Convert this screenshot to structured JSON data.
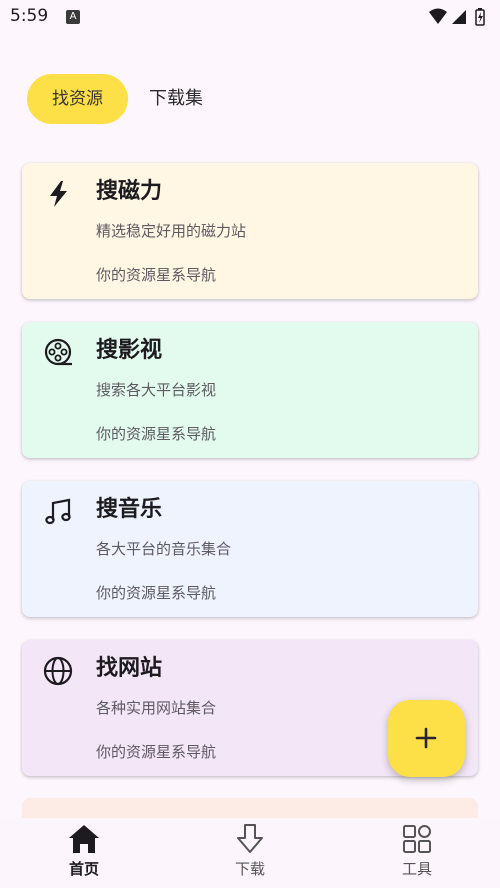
{
  "status_bar": {
    "time": "5:59",
    "app_icon_letter": "A"
  },
  "tabs": [
    {
      "label": "找资源",
      "active": true
    },
    {
      "label": "下载集",
      "active": false
    }
  ],
  "cards": [
    {
      "title": "搜磁力",
      "description": "精选稳定好用的磁力站",
      "tag": "你的资源星系导航",
      "icon": "lightning-icon",
      "bg": "#fff7e3"
    },
    {
      "title": "搜影视",
      "description": "搜索各大平台影视",
      "tag": "你的资源星系导航",
      "icon": "film-reel-icon",
      "bg": "#e3fbee"
    },
    {
      "title": "搜音乐",
      "description": "各大平台的音乐集合",
      "tag": "你的资源星系导航",
      "icon": "music-note-icon",
      "bg": "#eef3fe"
    },
    {
      "title": "找网站",
      "description": "各种实用网站集合",
      "tag": "你的资源星系导航",
      "icon": "globe-icon",
      "bg": "#f3e6f7"
    }
  ],
  "partial_card_bg": "#fdebe6",
  "fab": {
    "icon": "plus-icon",
    "color": "#fde047"
  },
  "bottom_nav": [
    {
      "label": "首页",
      "icon": "home-icon",
      "active": true
    },
    {
      "label": "下载",
      "icon": "download-icon",
      "active": false
    },
    {
      "label": "工具",
      "icon": "grid-icon",
      "active": false
    }
  ]
}
